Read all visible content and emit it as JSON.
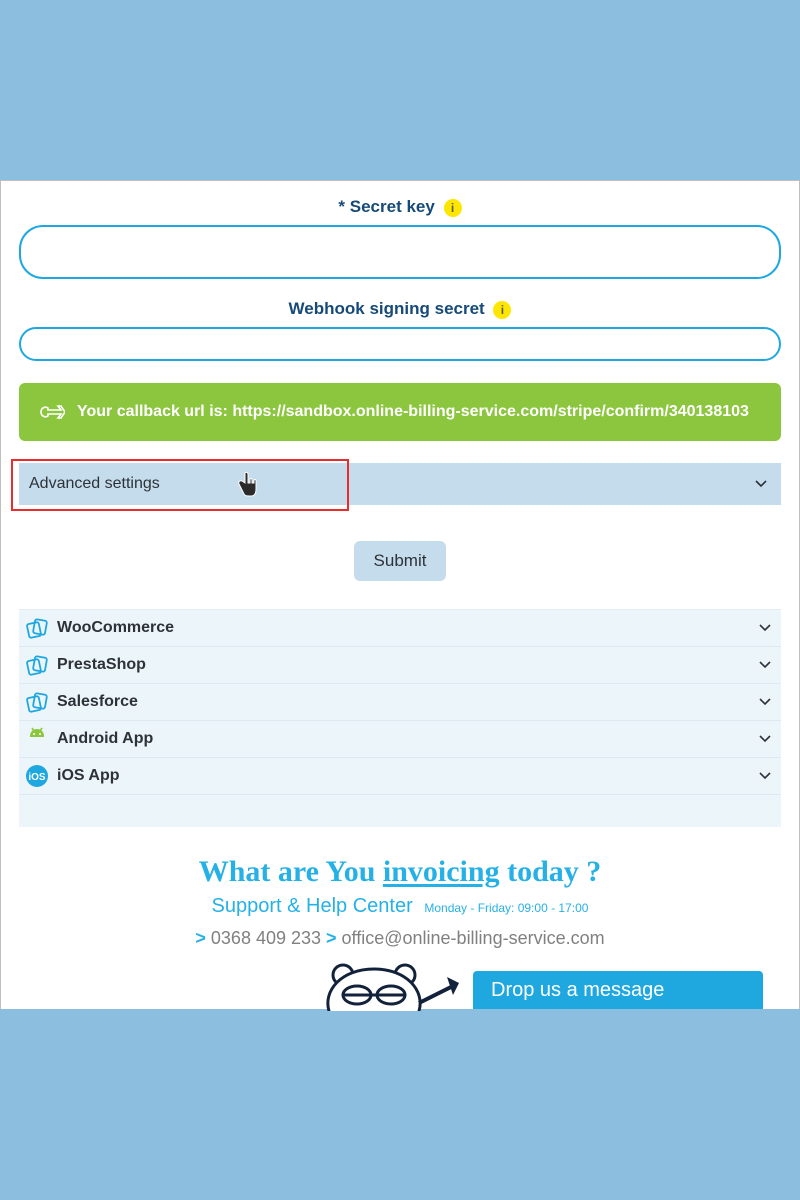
{
  "fields": {
    "secret_key": {
      "label": "Secret key",
      "required_mark": "*",
      "value": ""
    },
    "webhook_secret": {
      "label": "Webhook signing secret",
      "value": ""
    }
  },
  "callback": {
    "prefix": "Your callback url is: ",
    "url": "https://sandbox.online-billing-service.com/stripe/confirm/340138103"
  },
  "advanced": {
    "label": "Advanced settings"
  },
  "submit_label": "Submit",
  "integrations": [
    {
      "label": "WooCommerce",
      "icon": "cards"
    },
    {
      "label": "PrestaShop",
      "icon": "cards"
    },
    {
      "label": "Salesforce",
      "icon": "cards"
    },
    {
      "label": "Android App",
      "icon": "android"
    },
    {
      "label": "iOS App",
      "icon": "ios"
    }
  ],
  "footer": {
    "tagline_pre": "What are You ",
    "tagline_under": "invoicing",
    "tagline_post": " today ?",
    "support_label": "Support & Help Center",
    "hours": "Monday - Friday: 09:00 - 17:00",
    "phone": "0368 409 233",
    "email": "office@online-billing-service.com",
    "drop_message": "Drop us a message"
  }
}
